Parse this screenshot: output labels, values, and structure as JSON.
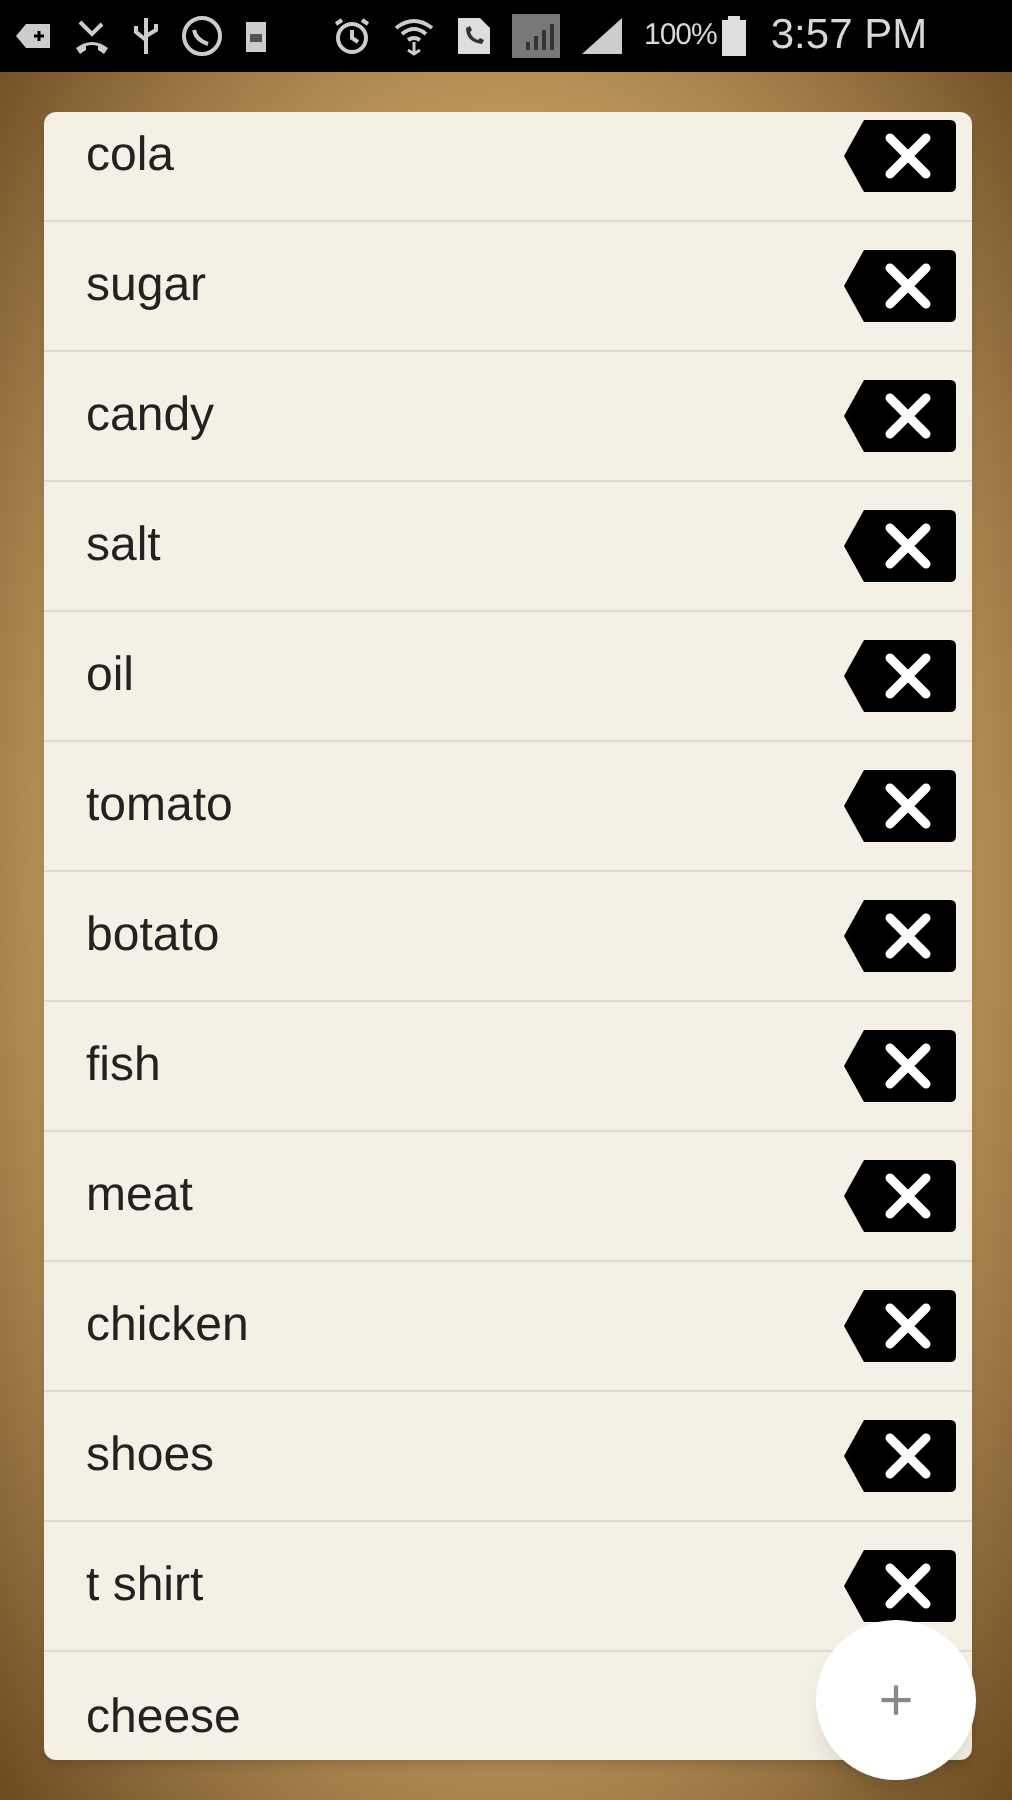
{
  "status_bar": {
    "battery_percent": "100%",
    "time": "3:57 PM"
  },
  "items": [
    {
      "label": "cola",
      "delete_button_shown": true
    },
    {
      "label": "sugar",
      "delete_button_shown": true
    },
    {
      "label": "candy",
      "delete_button_shown": true
    },
    {
      "label": "salt",
      "delete_button_shown": true
    },
    {
      "label": "oil",
      "delete_button_shown": true
    },
    {
      "label": "tomato",
      "delete_button_shown": true
    },
    {
      "label": "botato",
      "delete_button_shown": true
    },
    {
      "label": "fish",
      "delete_button_shown": true
    },
    {
      "label": "meat",
      "delete_button_shown": true
    },
    {
      "label": "chicken",
      "delete_button_shown": true
    },
    {
      "label": "shoes",
      "delete_button_shown": true
    },
    {
      "label": "t shirt",
      "delete_button_shown": true
    },
    {
      "label": "cheese",
      "delete_button_shown": false
    }
  ],
  "add_button": {
    "label": "+"
  }
}
